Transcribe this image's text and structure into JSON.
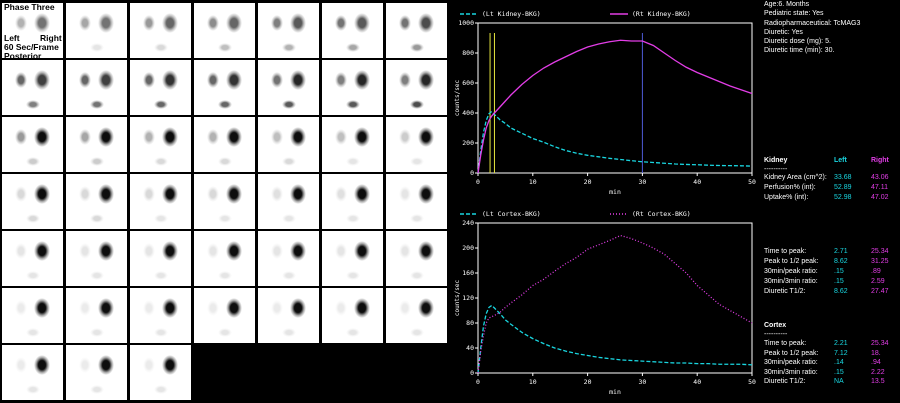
{
  "scan": {
    "phase_label": "Phase Three",
    "left_label": "Left",
    "right_label": "Right",
    "frame_rate_label": "60 Sec/Frame",
    "view_label": "Posterior",
    "frames": [
      {
        "l": 0.3,
        "r": 0.55,
        "b": 0.0
      },
      {
        "l": 0.35,
        "r": 0.55,
        "b": 0.1
      },
      {
        "l": 0.4,
        "r": 0.6,
        "b": 0.15
      },
      {
        "l": 0.45,
        "r": 0.6,
        "b": 0.25
      },
      {
        "l": 0.5,
        "r": 0.65,
        "b": 0.3
      },
      {
        "l": 0.55,
        "r": 0.65,
        "b": 0.35
      },
      {
        "l": 0.55,
        "r": 0.7,
        "b": 0.4
      },
      {
        "l": 0.6,
        "r": 0.75,
        "b": 0.5
      },
      {
        "l": 0.6,
        "r": 0.75,
        "b": 0.55
      },
      {
        "l": 0.6,
        "r": 0.8,
        "b": 0.6
      },
      {
        "l": 0.6,
        "r": 0.8,
        "b": 0.6
      },
      {
        "l": 0.55,
        "r": 0.85,
        "b": 0.65
      },
      {
        "l": 0.5,
        "r": 0.85,
        "b": 0.65
      },
      {
        "l": 0.5,
        "r": 0.85,
        "b": 0.7
      },
      {
        "l": 0.4,
        "r": 0.95,
        "b": 0.2
      },
      {
        "l": 0.35,
        "r": 0.95,
        "b": 0.2
      },
      {
        "l": 0.3,
        "r": 0.95,
        "b": 0.15
      },
      {
        "l": 0.3,
        "r": 0.95,
        "b": 0.15
      },
      {
        "l": 0.25,
        "r": 0.95,
        "b": 0.15
      },
      {
        "l": 0.25,
        "r": 0.95,
        "b": 0.1
      },
      {
        "l": 0.2,
        "r": 0.95,
        "b": 0.1
      },
      {
        "l": 0.15,
        "r": 0.95,
        "b": 0.15
      },
      {
        "l": 0.15,
        "r": 0.95,
        "b": 0.15
      },
      {
        "l": 0.15,
        "r": 0.95,
        "b": 0.1
      },
      {
        "l": 0.15,
        "r": 0.95,
        "b": 0.1
      },
      {
        "l": 0.12,
        "r": 0.95,
        "b": 0.1
      },
      {
        "l": 0.12,
        "r": 0.95,
        "b": 0.1
      },
      {
        "l": 0.1,
        "r": 0.95,
        "b": 0.1
      },
      {
        "l": 0.1,
        "r": 0.95,
        "b": 0.1
      },
      {
        "l": 0.1,
        "r": 0.95,
        "b": 0.1
      },
      {
        "l": 0.1,
        "r": 0.95,
        "b": 0.1
      },
      {
        "l": 0.1,
        "r": 0.95,
        "b": 0.1
      },
      {
        "l": 0.1,
        "r": 0.95,
        "b": 0.1
      },
      {
        "l": 0.1,
        "r": 0.95,
        "b": 0.1
      },
      {
        "l": 0.1,
        "r": 0.95,
        "b": 0.1
      },
      {
        "l": 0.08,
        "r": 0.95,
        "b": 0.1
      },
      {
        "l": 0.08,
        "r": 0.95,
        "b": 0.1
      },
      {
        "l": 0.08,
        "r": 0.95,
        "b": 0.1
      },
      {
        "l": 0.08,
        "r": 0.95,
        "b": 0.1
      },
      {
        "l": 0.08,
        "r": 0.95,
        "b": 0.1
      },
      {
        "l": 0.08,
        "r": 0.95,
        "b": 0.1
      },
      {
        "l": 0.08,
        "r": 0.95,
        "b": 0.1
      },
      {
        "l": 0.08,
        "r": 0.95,
        "b": 0.1
      },
      {
        "l": 0.08,
        "r": 0.95,
        "b": 0.1
      },
      {
        "l": 0.08,
        "r": 0.95,
        "b": 0.1
      }
    ]
  },
  "patient": {
    "age": "Age:6. Months",
    "pediatric": "Pediatric state: Yes",
    "radiopharm": "Radiopharmaceutical: TcMAG3",
    "diuretic": "Diuretic: Yes",
    "diuretic_dose": "Diuretic dose (mg): 5.",
    "diuretic_time": "Diuretic time (min): 30."
  },
  "kidney_stats": {
    "header": {
      "label": "Kidney",
      "left": "Left",
      "right": "Right"
    },
    "separator": "----------",
    "rows": [
      {
        "label": "Kidney Area (cm^2):",
        "left": "33.68",
        "right": "43.06"
      },
      {
        "label": "Perfusion% (int):",
        "left": "52.89",
        "right": "47.11"
      },
      {
        "label": "Uptake% (int):",
        "left": "52.98",
        "right": "47.02"
      }
    ]
  },
  "kidney_timing": {
    "rows": [
      {
        "label": "Time to peak:",
        "left": "2.71",
        "right": "25.34"
      },
      {
        "label": "Peak to 1/2 peak:",
        "left": "8.62",
        "right": "31.25"
      },
      {
        "label": "30min/peak ratio:",
        "left": ".15",
        "right": ".89"
      },
      {
        "label": "30min/3min ratio:",
        "left": ".15",
        "right": "2.59"
      },
      {
        "label": "Diuretic T1/2:",
        "left": "8.62",
        "right": "27.47"
      }
    ]
  },
  "cortex_stats": {
    "header": "Cortex",
    "separator": "----------",
    "rows": [
      {
        "label": "Time to peak:",
        "left": "2.21",
        "right": "25.34"
      },
      {
        "label": "Peak to 1/2 peak:",
        "left": "7.12",
        "right": "18."
      },
      {
        "label": "30min/peak ratio:",
        "left": ".14",
        "right": ".94"
      },
      {
        "label": "30min/3min ratio:",
        "left": ".15",
        "right": "2.22"
      },
      {
        "label": "Diuretic T1/2:",
        "left": "NA",
        "right": "13.5"
      }
    ]
  },
  "colors": {
    "left": "#19d6e0",
    "right": "#e23de6",
    "marker_yellow": "#e8e840",
    "marker_blue": "#4f5bd8",
    "axes": "#ffffff"
  },
  "chart_data": [
    {
      "type": "line",
      "legend": [
        "(Lt Kidney-BKG)",
        "(Rt Kidney-BKG)"
      ],
      "xlabel": "min",
      "ylabel": "counts/sec",
      "xlim": [
        0,
        50
      ],
      "ylim": [
        0,
        1000
      ],
      "xticks": [
        "0",
        "10",
        "20",
        "30",
        "40",
        "50"
      ],
      "yticks": [
        "0",
        "200",
        "400",
        "600",
        "800",
        "1000"
      ],
      "series": [
        {
          "name": "(Lt Kidney-BKG)",
          "style": "dashed",
          "x": [
            0,
            0.5,
            1,
            1.5,
            2,
            2.5,
            3,
            4,
            5,
            6,
            8,
            10,
            12,
            14,
            16,
            18,
            20,
            22,
            24,
            26,
            28,
            30,
            32,
            34,
            36,
            38,
            40,
            42,
            44,
            46,
            48,
            50
          ],
          "y": [
            0,
            150,
            270,
            350,
            395,
            410,
            390,
            355,
            330,
            300,
            265,
            230,
            205,
            175,
            150,
            132,
            118,
            108,
            98,
            90,
            82,
            75,
            70,
            65,
            60,
            57,
            55,
            52,
            50,
            49,
            48,
            46
          ]
        },
        {
          "name": "(Rt Kidney-BKG)",
          "style": "solid",
          "x": [
            0,
            0.5,
            1,
            1.5,
            2,
            2.5,
            3,
            4,
            5,
            6,
            8,
            10,
            12,
            14,
            16,
            18,
            20,
            22,
            24,
            26,
            28,
            30,
            32,
            34,
            36,
            38,
            40,
            42,
            44,
            46,
            48,
            50
          ],
          "y": [
            0,
            120,
            220,
            300,
            350,
            380,
            400,
            440,
            480,
            520,
            590,
            650,
            700,
            740,
            775,
            810,
            840,
            860,
            875,
            885,
            880,
            880,
            850,
            800,
            750,
            705,
            670,
            640,
            610,
            580,
            555,
            530
          ]
        }
      ],
      "markers": [
        {
          "x": 2.2,
          "color": "yellow"
        },
        {
          "x": 3,
          "color": "yellow"
        },
        {
          "x": 30,
          "color": "blue"
        }
      ]
    },
    {
      "type": "line",
      "legend": [
        "(Lt Cortex-BKG)",
        "(Rt Cortex-BKG)"
      ],
      "xlabel": "min",
      "ylabel": "counts/sec",
      "xlim": [
        0,
        50
      ],
      "ylim": [
        0,
        240
      ],
      "xticks": [
        "0",
        "10",
        "20",
        "30",
        "40",
        "50"
      ],
      "yticks": [
        "0",
        "40",
        "80",
        "120",
        "160",
        "200",
        "240"
      ],
      "series": [
        {
          "name": "(Lt Cortex-BKG)",
          "style": "dashed",
          "x": [
            0,
            0.5,
            1,
            1.5,
            2,
            2.5,
            3,
            4,
            5,
            6,
            8,
            10,
            12,
            14,
            16,
            18,
            20,
            22,
            24,
            26,
            28,
            30,
            32,
            34,
            36,
            38,
            40,
            42,
            44,
            46,
            48,
            50
          ],
          "y": [
            0,
            40,
            75,
            95,
            105,
            108,
            104,
            95,
            85,
            78,
            65,
            55,
            47,
            40,
            35,
            31,
            28,
            25,
            23,
            21,
            20,
            19,
            18,
            17,
            16,
            16,
            15,
            15,
            14,
            14,
            14,
            13
          ]
        },
        {
          "name": "(Rt Cortex-BKG)",
          "style": "dotted",
          "x": [
            0,
            0.5,
            1,
            1.5,
            2,
            2.5,
            3,
            4,
            5,
            6,
            8,
            10,
            12,
            14,
            16,
            18,
            20,
            22,
            24,
            26,
            28,
            30,
            32,
            34,
            36,
            38,
            40,
            42,
            44,
            46,
            48,
            50
          ],
          "y": [
            0,
            35,
            60,
            80,
            88,
            90,
            92,
            97,
            105,
            112,
            125,
            140,
            150,
            163,
            175,
            185,
            198,
            205,
            212,
            220,
            215,
            208,
            200,
            190,
            175,
            160,
            140,
            125,
            110,
            100,
            90,
            80
          ]
        }
      ]
    }
  ]
}
